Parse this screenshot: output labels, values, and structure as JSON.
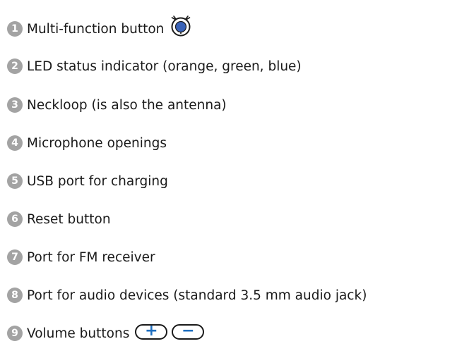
{
  "legend": {
    "items": [
      {
        "number": "1",
        "text": "Multi-function button",
        "icon": "multi-function-button-icon"
      },
      {
        "number": "2",
        "text": "LED status indicator (orange, green, blue)"
      },
      {
        "number": "3",
        "text": "Neckloop (is also the antenna)"
      },
      {
        "number": "4",
        "text": "Microphone openings"
      },
      {
        "number": "5",
        "text": "USB port for charging"
      },
      {
        "number": "6",
        "text": "Reset button"
      },
      {
        "number": "7",
        "text": "Port for FM receiver"
      },
      {
        "number": "8",
        "text": "Port for audio devices (standard 3.5 mm audio jack)"
      },
      {
        "number": "9",
        "text": "Volume buttons",
        "buttons": [
          "+",
          "−"
        ]
      }
    ]
  },
  "colors": {
    "badge": "#a3a3a3",
    "icon_blue": "#3a63b8",
    "button_glyph": "#1f6fc0",
    "text": "#1a1a1a"
  }
}
